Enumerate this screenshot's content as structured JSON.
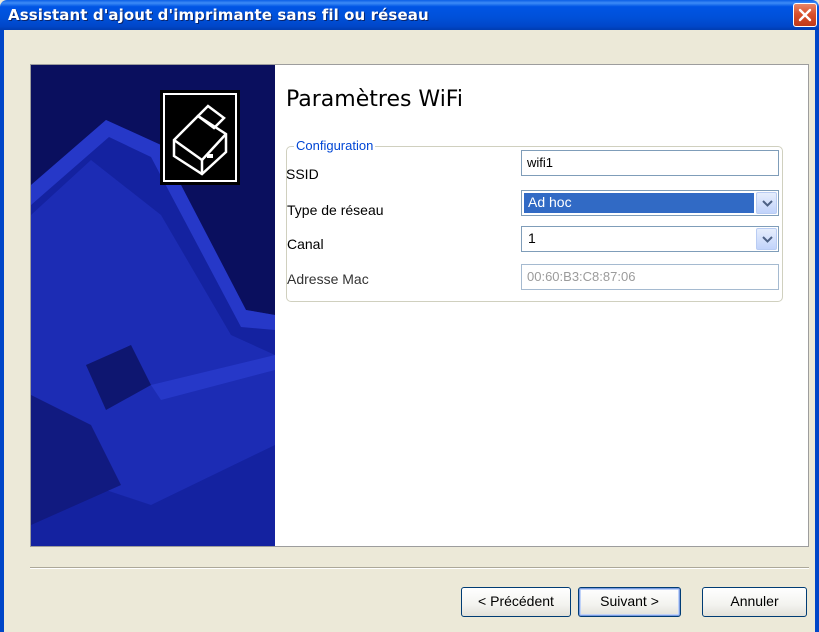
{
  "window": {
    "title": "Assistant d'ajout d'imprimante sans fil ou réseau"
  },
  "page": {
    "heading": "Paramètres WiFi"
  },
  "configuration": {
    "legend": "Configuration",
    "ssid_label": "SSID",
    "ssid_value": "wifi1",
    "network_type_label": "Type de réseau",
    "network_type_value": "Ad hoc",
    "channel_label": "Canal",
    "channel_value": "1",
    "mac_label": "Adresse Mac",
    "mac_value": "00:60:B3:C8:87:06"
  },
  "buttons": {
    "back": "< Précédent",
    "next": "Suivant >",
    "cancel": "Annuler"
  },
  "icons": {
    "close": "close-icon",
    "printer": "printer-icon",
    "dropdown": "chevron-down-icon"
  },
  "colors": {
    "titlebar": "#0054E3",
    "side_panel": "#0A0F5E",
    "legend": "#0046D5",
    "selection": "#316AC5"
  }
}
